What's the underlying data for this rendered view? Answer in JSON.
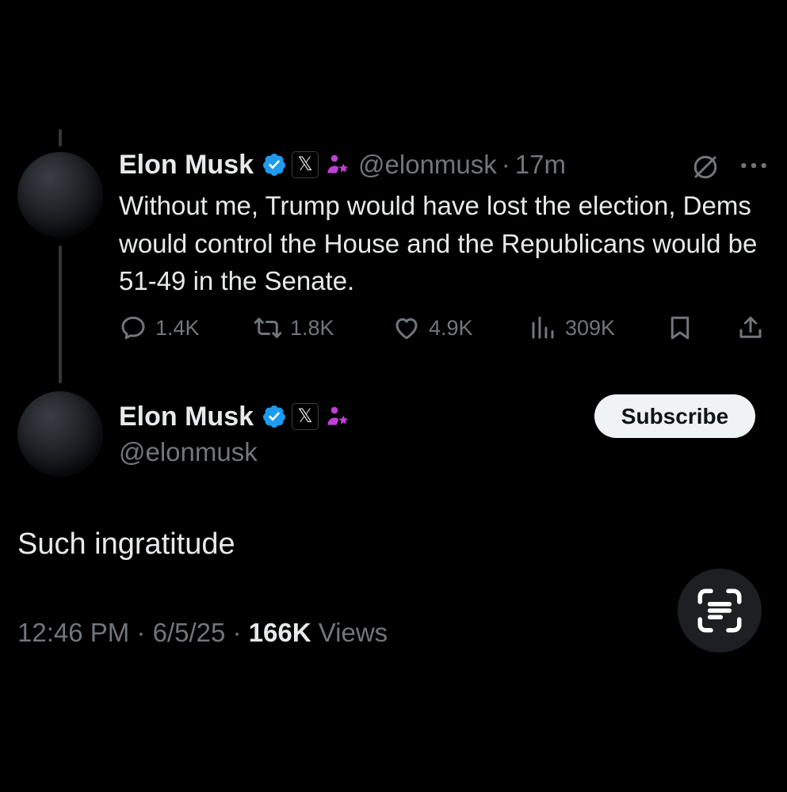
{
  "parent_tweet": {
    "display_name": "Elon Musk",
    "x_badge": "𝕏",
    "handle": "@elonmusk",
    "separator": "·",
    "time": "17m",
    "text": "Without me, Trump would have lost the election, Dems would control the House and the Republicans would be 51-49 in the Senate.",
    "stats": {
      "replies": "1.4K",
      "reposts": "1.8K",
      "likes": "4.9K",
      "views": "309K"
    }
  },
  "reply_tweet": {
    "display_name": "Elon Musk",
    "x_badge": "𝕏",
    "handle": "@elonmusk",
    "subscribe_label": "Subscribe",
    "text": "Such ingratitude",
    "meta": {
      "time": "12:46 PM",
      "separator": "·",
      "date": "6/5/25",
      "views_count": "166K",
      "views_label": "Views"
    }
  },
  "colors": {
    "background": "#000000",
    "text_primary": "#e7e9ea",
    "text_secondary": "#71767b",
    "verified_blue": "#1d9bf0",
    "affiliation_purple": "#c13fd6",
    "subscribe_bg": "#eff3f4"
  },
  "icons": [
    "verified-badge-icon",
    "x-affiliate-icon",
    "grok-icon",
    "more-icon",
    "reply-icon",
    "repost-icon",
    "like-icon",
    "views-icon",
    "bookmark-icon",
    "share-icon",
    "text-scan-icon"
  ]
}
